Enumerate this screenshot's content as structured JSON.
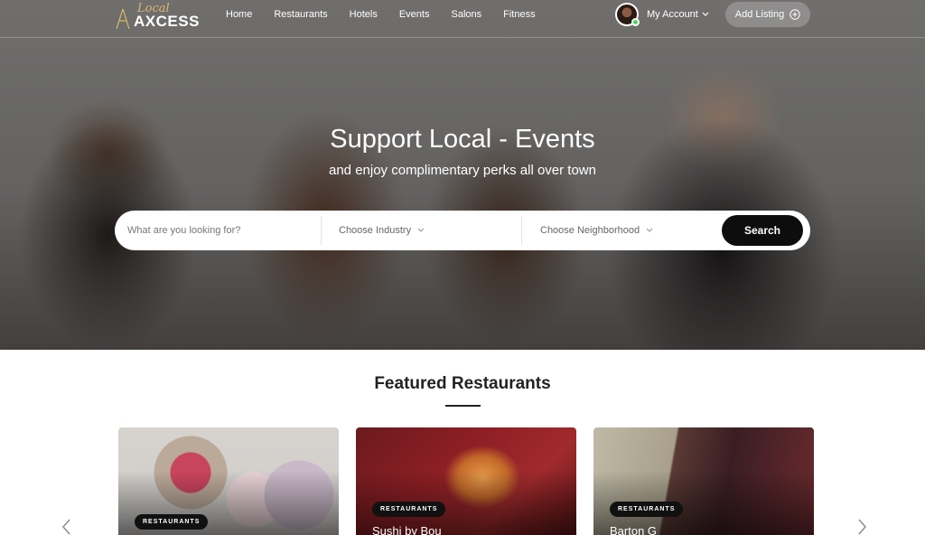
{
  "nav": {
    "logo_script": "Local",
    "logo_main": "AXCESS",
    "links": [
      "Home",
      "Restaurants",
      "Hotels",
      "Events",
      "Salons",
      "Fitness"
    ],
    "account_label": "My Account",
    "add_listing": "Add Listing"
  },
  "hero": {
    "title": "Support Local - Events",
    "subtitle": "and enjoy complimentary perks all over town"
  },
  "search": {
    "placeholder": "What are you looking for?",
    "industry_label": "Choose Industry",
    "neighborhood_label": "Choose Neighborhood",
    "button_label": "Search"
  },
  "featured": {
    "title": "Featured Restaurants",
    "cards": [
      {
        "tag": "RESTAURANTS",
        "name": ""
      },
      {
        "tag": "RESTAURANTS",
        "name": "Sushi by Bou"
      },
      {
        "tag": "RESTAURANTS",
        "name": "Barton G"
      }
    ]
  },
  "colors": {
    "accent_gold": "#d9b96a",
    "button_dark": "#0d0d0d",
    "online_status": "#4cd964"
  }
}
